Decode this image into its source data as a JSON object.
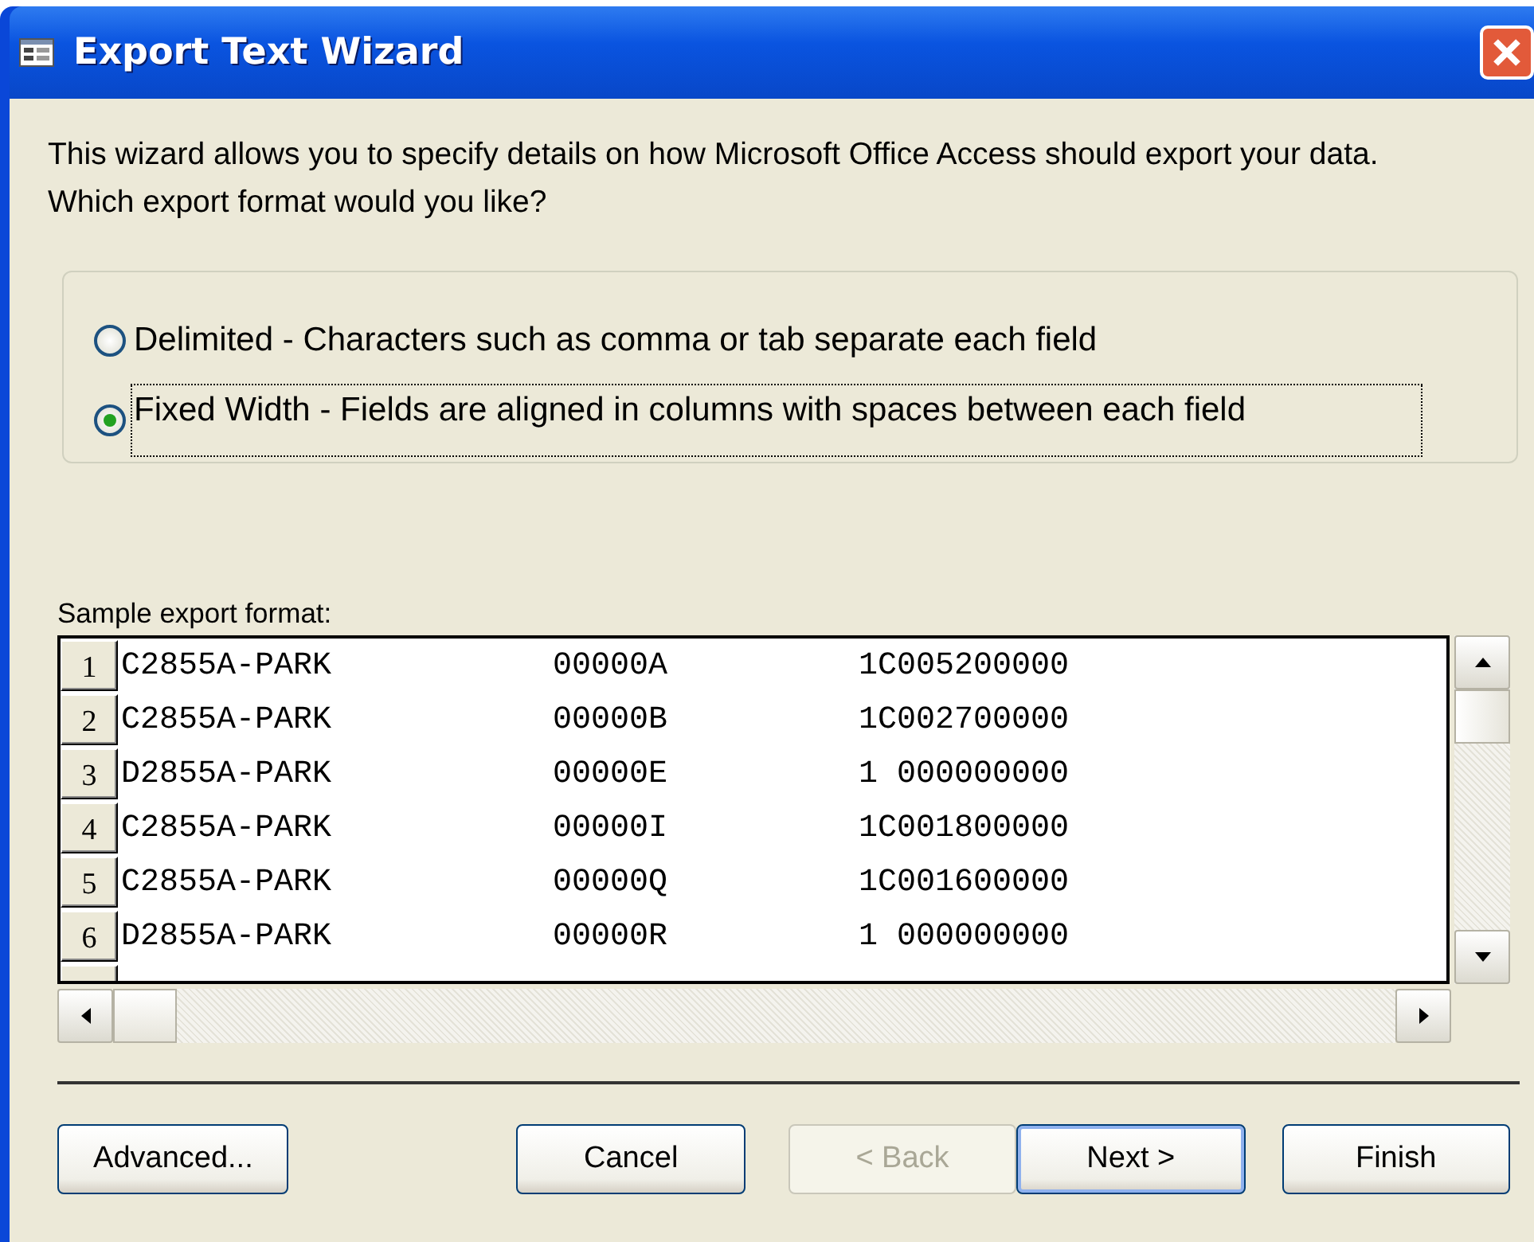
{
  "window": {
    "title": "Export Text Wizard"
  },
  "intro": "This wizard allows you to specify details on how Microsoft Office Access should export your data. Which export format would you like?",
  "options": [
    {
      "label": "Delimited - Characters such as comma or tab separate each field",
      "selected": false,
      "focused": false
    },
    {
      "label": "Fixed Width - Fields are aligned in columns with spaces between each field",
      "selected": true,
      "focused": true
    }
  ],
  "sample": {
    "label": "Sample export format:",
    "rows": [
      {
        "number": "1",
        "cells": [
          "C2855A-PARK",
          "00000A",
          "1C005200000"
        ]
      },
      {
        "number": "2",
        "cells": [
          "C2855A-PARK",
          "00000B",
          "1C002700000"
        ]
      },
      {
        "number": "3",
        "cells": [
          "D2855A-PARK",
          "00000E",
          "1 000000000"
        ]
      },
      {
        "number": "4",
        "cells": [
          "C2855A-PARK",
          "00000I",
          "1C001800000"
        ]
      },
      {
        "number": "5",
        "cells": [
          "C2855A-PARK",
          "00000Q",
          "1C001600000"
        ]
      },
      {
        "number": "6",
        "cells": [
          "D2855A-PARK",
          "00000R",
          "1 000000000"
        ]
      }
    ]
  },
  "buttons": [
    {
      "label": "Advanced...",
      "disabled": false,
      "default": false
    },
    {
      "label": "Cancel",
      "disabled": false,
      "default": false
    },
    {
      "label": "< Back",
      "disabled": true,
      "default": false
    },
    {
      "label": "Next >",
      "disabled": false,
      "default": true
    },
    {
      "label": "Finish",
      "disabled": false,
      "default": false
    }
  ]
}
